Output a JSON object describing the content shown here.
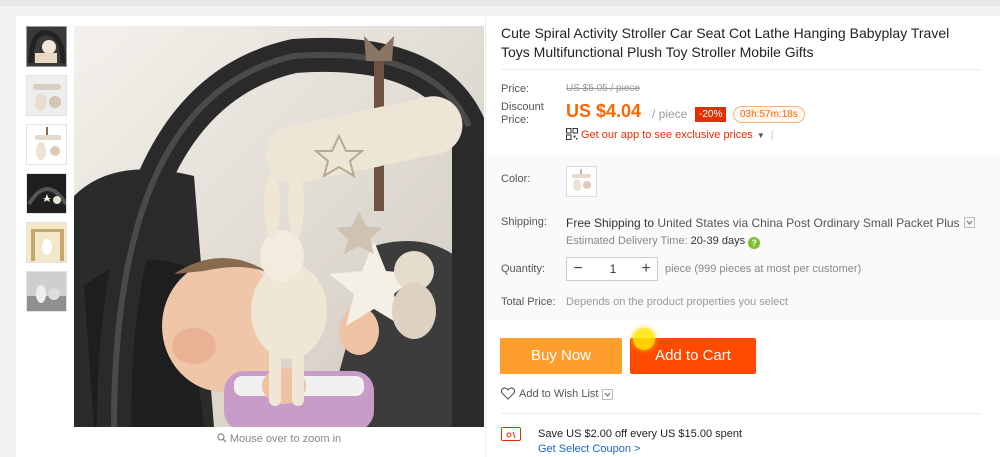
{
  "product": {
    "title": "Cute Spiral Activity Stroller Car Seat Cot Lathe Hanging Babyplay Travel Toys Multifunctional Plush Toy Stroller Mobile Gifts"
  },
  "gallery": {
    "zoom_hint": "Mouse over to zoom in",
    "thumbnails": [
      "thumb-1",
      "thumb-2",
      "thumb-3",
      "thumb-4",
      "thumb-5",
      "thumb-6"
    ]
  },
  "price": {
    "label": "Price:",
    "original": "US $5.05 / piece",
    "discount_label": "Discount Price:",
    "current": "US $4.04",
    "unit": "/ piece",
    "discount_badge": "-20%",
    "countdown": "03h:57m:18s",
    "app_promo": "Get our app to see exclusive prices"
  },
  "options": {
    "color_label": "Color:",
    "shipping_label": "Shipping:",
    "shipping_free": "Free Shipping to",
    "shipping_detail": "United States via China Post Ordinary Small Packet Plus",
    "estimated_label": "Estimated Delivery Time:",
    "estimated_days": "20-39 days",
    "quantity_label": "Quantity:",
    "quantity_value": "1",
    "quantity_note": "piece (999 pieces at most per customer)",
    "total_label": "Total Price:",
    "total_note": "Depends on the product properties you select"
  },
  "actions": {
    "buy_now": "Buy Now",
    "add_to_cart": "Add to Cart",
    "wish_list": "Add to Wish List"
  },
  "coupon": {
    "text": "Save US $2.00 off every US $15.00 spent",
    "link": "Get Select Coupon >"
  },
  "colors": {
    "accent": "#ff6600",
    "add_to_cart": "#ff4a00",
    "buy_now": "#ff9e2d",
    "discount": "#e62e04",
    "link": "#1a66c2"
  },
  "icons": [
    "search-icon",
    "qr-code-icon",
    "chevron-down-icon",
    "help-icon",
    "heart-icon",
    "coupon-icon"
  ]
}
